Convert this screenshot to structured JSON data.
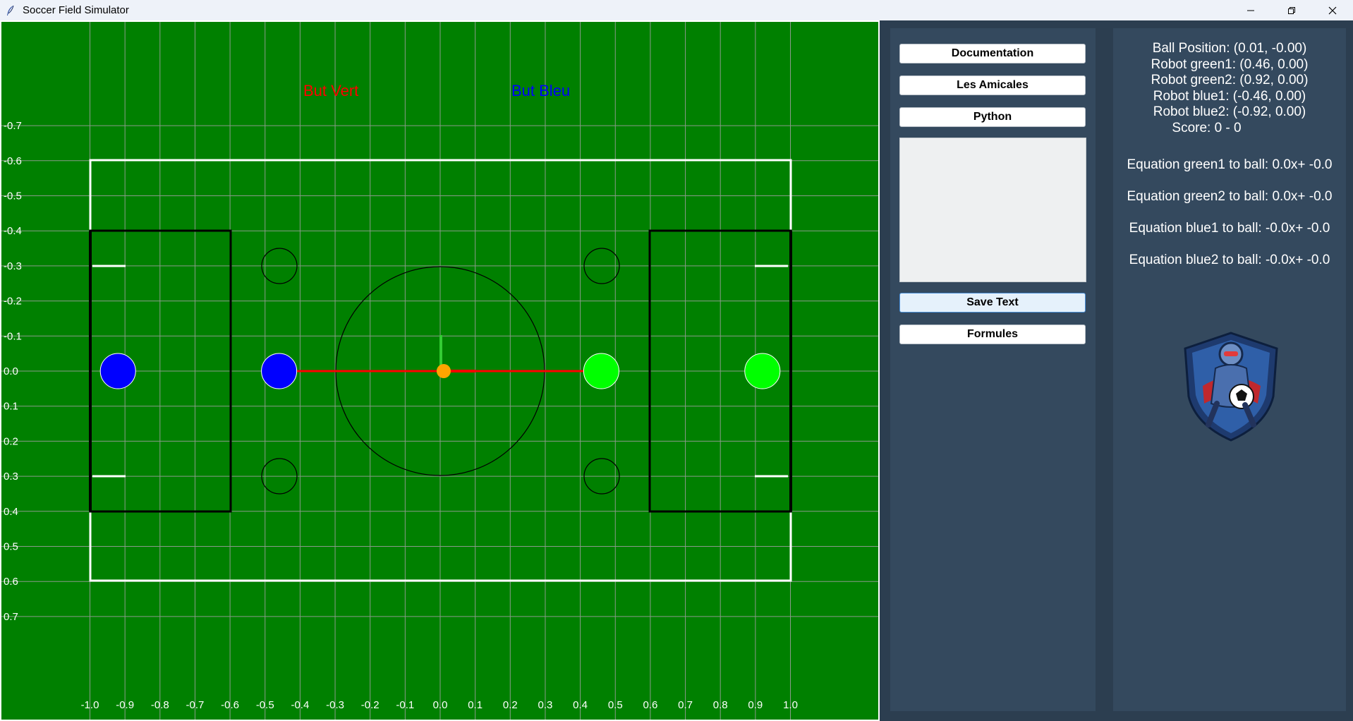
{
  "window": {
    "title": "Soccer Field Simulator"
  },
  "field": {
    "goal_labels": {
      "green": "But Vert",
      "blue": "But Bleu"
    },
    "x_ticks": [
      "-1.0",
      "-0.9",
      "-0.8",
      "-0.7",
      "-0.6",
      "-0.5",
      "-0.4",
      "-0.3",
      "-0.2",
      "-0.1",
      "0.0",
      "0.1",
      "0.2",
      "0.3",
      "0.4",
      "0.5",
      "0.6",
      "0.7",
      "0.8",
      "0.9",
      "1.0"
    ],
    "y_ticks": [
      "-0.7",
      "-0.6",
      "-0.5",
      "-0.4",
      "-0.3",
      "-0.2",
      "-0.1",
      "0.0",
      "0.1",
      "0.2",
      "0.3",
      "0.4",
      "0.5",
      "0.6",
      "0.7"
    ],
    "ball": {
      "x": 0.01,
      "y": 0.0
    },
    "robots": [
      {
        "name": "blue2",
        "team": "blue",
        "x": -0.92,
        "y": 0.0
      },
      {
        "name": "blue1",
        "team": "blue",
        "x": -0.46,
        "y": 0.0
      },
      {
        "name": "green1",
        "team": "green",
        "x": 0.46,
        "y": 0.0
      },
      {
        "name": "green2",
        "team": "green",
        "x": 0.92,
        "y": 0.0
      }
    ],
    "colors": {
      "grass": "#008000",
      "grid": "#8a9a8a",
      "blue_robot": "#0000ff",
      "green_robot": "#00ff00",
      "ball": "#ffa500",
      "green_goal_label": "#ff0000",
      "blue_goal_label": "#0000ff"
    }
  },
  "controls": {
    "documentation": "Documentation",
    "amicales": "Les Amicales",
    "python": "Python",
    "save_text": "Save Text",
    "formules": "Formules",
    "textbox_value": ""
  },
  "info": {
    "ball_position": "Ball Position: (0.01, -0.00)",
    "robot_green1": "Robot green1: (0.46, 0.00)",
    "robot_green2": "Robot green2: (0.92, 0.00)",
    "robot_blue1": "Robot blue1: (-0.46, 0.00)",
    "robot_blue2": "Robot blue2: (-0.92, 0.00)",
    "score": "Score: 0 - 0",
    "eq_green1": "Equation green1 to ball: 0.0x+ -0.0",
    "eq_green2": "Equation green2 to ball: 0.0x+ -0.0",
    "eq_blue1": "Equation blue1 to ball: -0.0x+ -0.0",
    "eq_blue2": "Equation blue2 to ball: -0.0x+ -0.0"
  }
}
